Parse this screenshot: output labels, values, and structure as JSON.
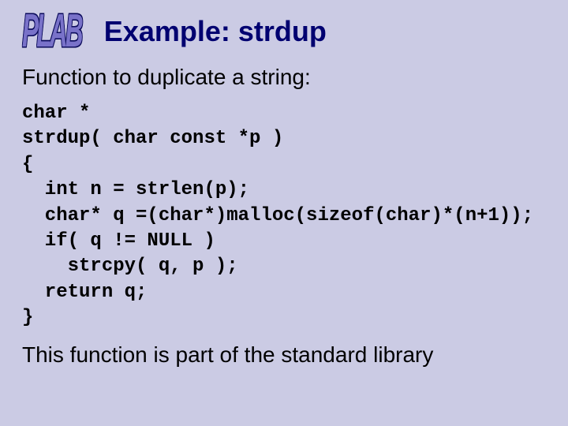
{
  "logo_text": "PLAB",
  "title": "Example: strdup",
  "subtitle": "Function to duplicate a string:",
  "code": "char *\nstrdup( char const *p )\n{\n  int n = strlen(p);\n  char* q =(char*)malloc(sizeof(char)*(n+1));\n  if( q != NULL )\n    strcpy( q, p );\n  return q;\n}",
  "footnote": "This function is part of the standard library"
}
